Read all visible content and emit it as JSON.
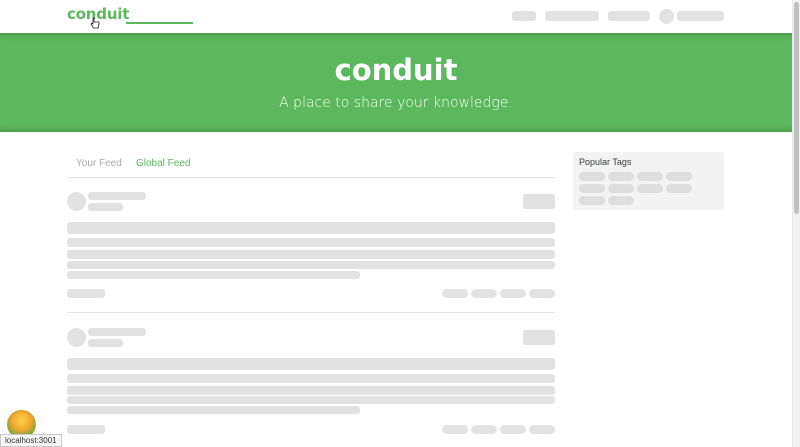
{
  "navbar": {
    "brand": "conduit"
  },
  "banner": {
    "title": "conduit",
    "subtitle": "A place to share your knowledge."
  },
  "feed": {
    "tabs": [
      {
        "label": "Your Feed",
        "active": false
      },
      {
        "label": "Global Feed",
        "active": true
      }
    ]
  },
  "sidebar": {
    "title": "Popular Tags"
  },
  "status": {
    "url": "localhost:3001"
  },
  "colors": {
    "brand": "#5cb85c",
    "skeleton": "#e2e2e2",
    "sidebar_bg": "#f3f3f3"
  }
}
